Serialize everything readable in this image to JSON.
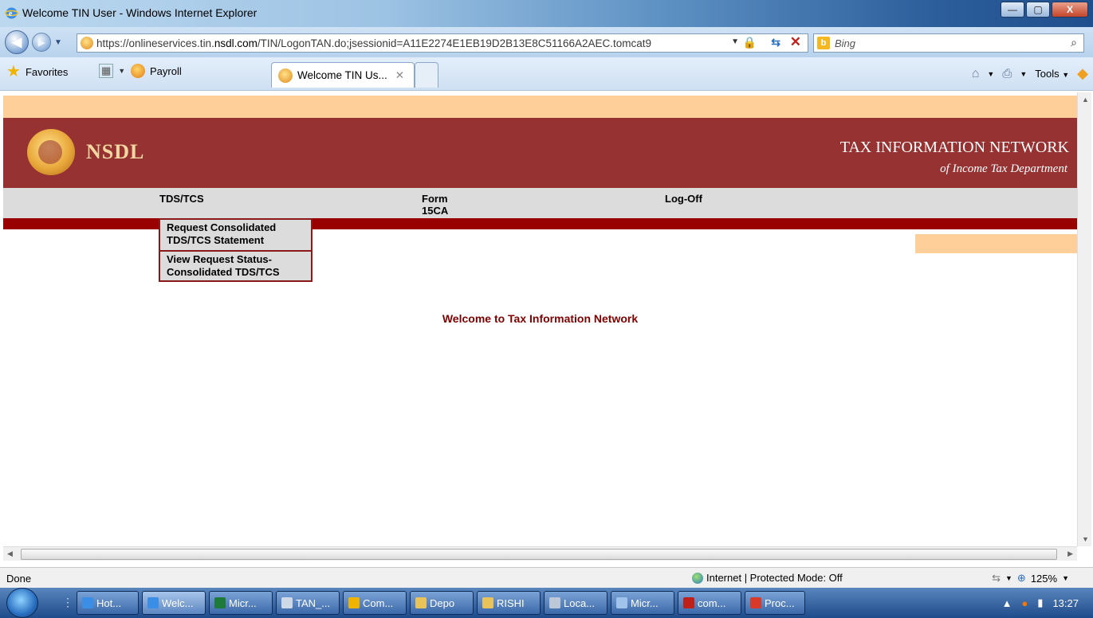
{
  "window": {
    "title": "Welcome TIN User - Windows Internet Explorer",
    "min_label": "—",
    "max_label": "▢",
    "close_label": "X"
  },
  "address": {
    "url_prefix": "https://onlineservices.tin.",
    "url_domain": "nsdl.com",
    "url_rest": "/TIN/LogonTAN.do;jsessionid=A11E2274E1EB19D2B13E8C51166A2AEC.tomcat9",
    "search_placeholder": "Bing"
  },
  "favorites": {
    "favorites_label": "Favorites",
    "payroll_label": "Payroll",
    "active_tab": "Welcome TIN Us...",
    "tools_label": "Tools"
  },
  "page": {
    "logo_text": "NSDL",
    "header_title": "TAX INFORMATION NETWORK",
    "header_subtitle": "of Income Tax Department",
    "menu": {
      "tds": "TDS/TCS",
      "form_line1": "Form",
      "form_line2": "15CA",
      "logoff": "Log-Off"
    },
    "submenu": {
      "item1_line1": "Request Consolidated",
      "item1_line2": "TDS/TCS Statement",
      "item2_line1": "View Request Status-",
      "item2_line2": "Consolidated TDS/TCS"
    },
    "welcome": "Welcome to Tax Information Network"
  },
  "status": {
    "done": "Done",
    "zone": "Internet | Protected Mode: Off",
    "zoom": "125%"
  },
  "taskbar": {
    "items": [
      "Hot...",
      "Welc...",
      "Micr...",
      "TAN_...",
      "Com...",
      "Depo",
      "RISHI",
      "Loca...",
      "Micr...",
      "com...",
      "Proc..."
    ],
    "clock": "13:27"
  },
  "colors": {
    "header_band": "#963232",
    "peach": "#ffcf99",
    "menu_gray": "#dcdcdc",
    "red_line": "#990000",
    "welcome_text": "#800000"
  }
}
